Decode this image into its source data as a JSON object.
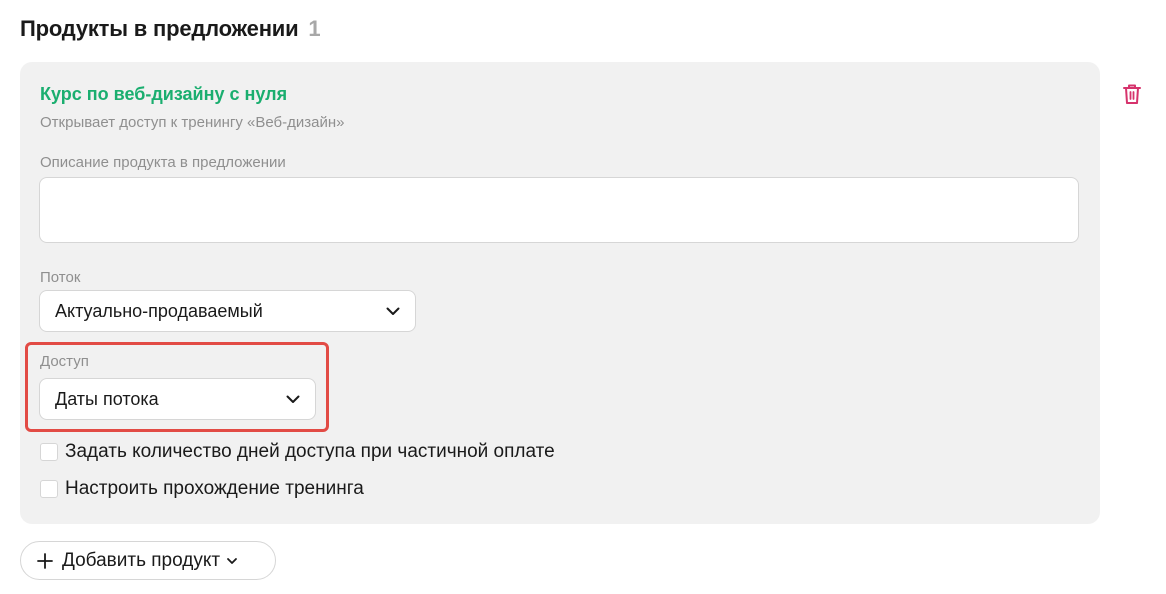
{
  "section": {
    "title": "Продукты в предложении",
    "count": "1"
  },
  "product": {
    "name": "Курс по веб-дизайну с нуля",
    "subtitle": "Открывает доступ к тренингу «Веб-дизайн»",
    "name_color": "#1aae6f",
    "description_label": "Описание продукта в предложении",
    "description_value": "",
    "stream_label": "Поток",
    "stream_value": "Актуально-продаваемый",
    "access_label": "Доступ",
    "access_value": "Даты потока",
    "checkboxes": [
      {
        "label": "Задать количество дней доступа при частичной оплате",
        "checked": false
      },
      {
        "label": "Настроить прохождение тренинга",
        "checked": false
      }
    ]
  },
  "actions": {
    "add_product_label": "Добавить продукт",
    "delete_icon": "trash-icon",
    "delete_color": "#d6336c"
  },
  "highlight": {
    "color": "#e24b45"
  }
}
